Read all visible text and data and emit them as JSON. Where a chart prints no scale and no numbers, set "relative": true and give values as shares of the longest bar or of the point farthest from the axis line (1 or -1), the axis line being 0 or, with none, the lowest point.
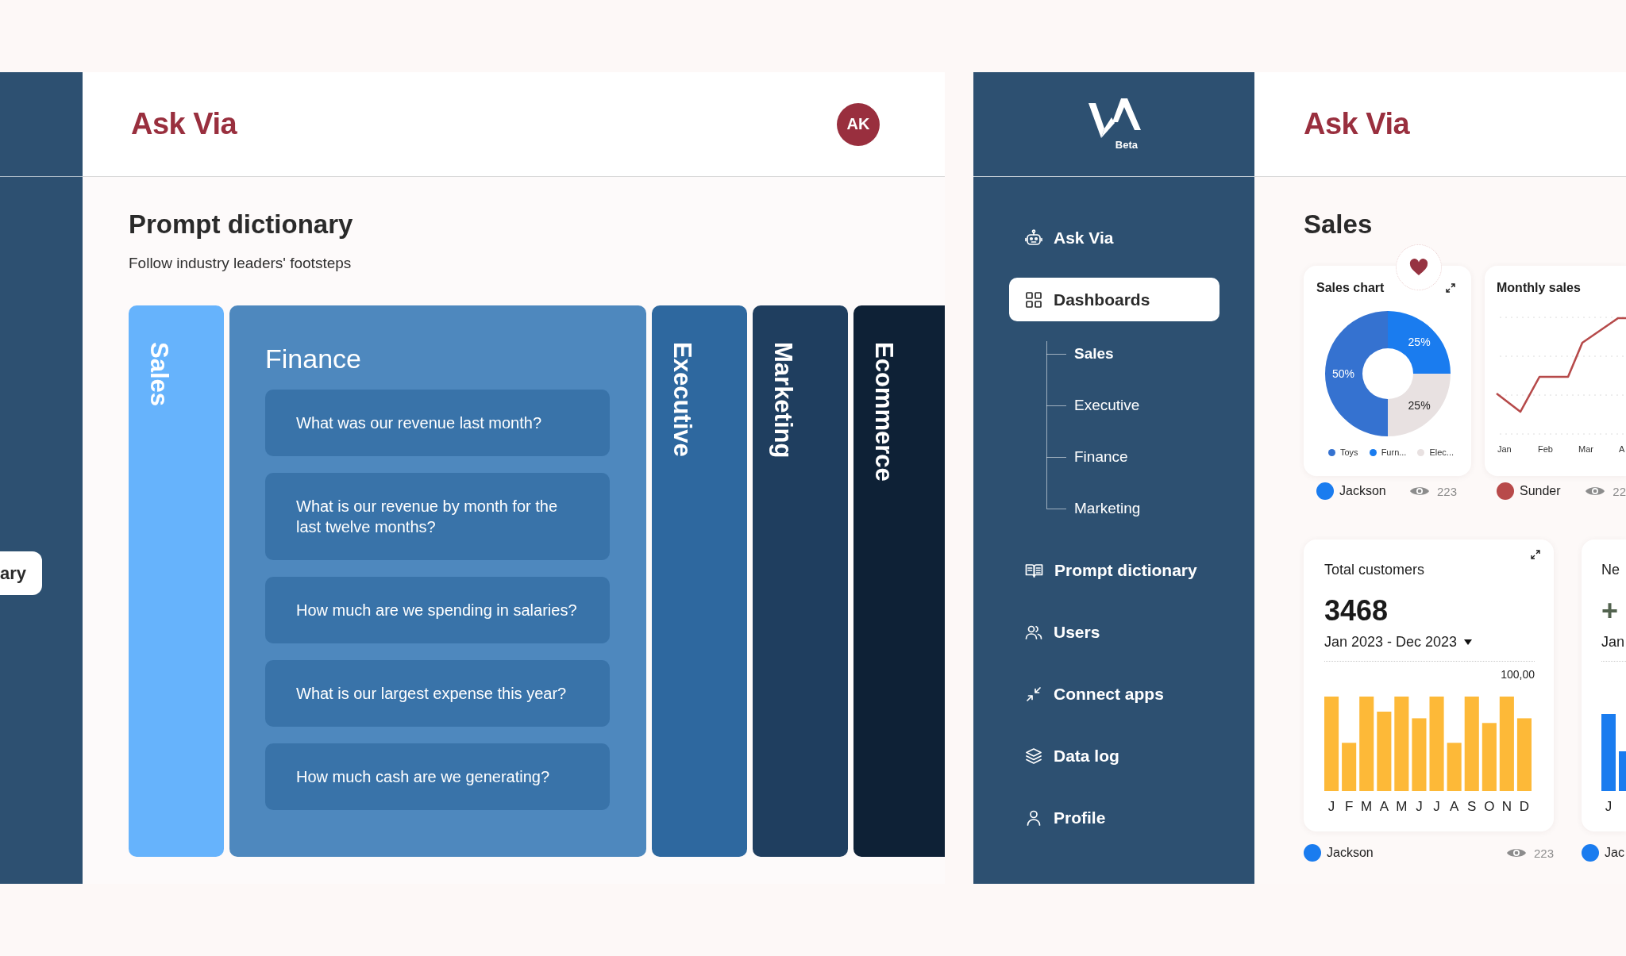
{
  "left_screen": {
    "nav_item": {
      "label": "ary",
      "selected": true
    },
    "header": {
      "title": "Ask Via",
      "avatar": "AK"
    },
    "page": {
      "title": "Prompt dictionary",
      "subtitle": "Follow industry leaders' footsteps"
    },
    "columns": [
      {
        "label": "Sales",
        "expanded": false,
        "color": "#66b3fc"
      },
      {
        "label": "Finance",
        "expanded": true,
        "color": "#4e88be",
        "prompts": [
          "What was our revenue last month?",
          "What is our revenue by month for the last twelve months?",
          "How much are we spending in salaries?",
          "What is our largest expense this year?",
          "How much cash are we generating?"
        ]
      },
      {
        "label": "Executive",
        "expanded": false,
        "color": "#2e689f"
      },
      {
        "label": "Marketing",
        "expanded": false,
        "color": "#1f3e5f"
      },
      {
        "label": "Ecommerce",
        "expanded": false,
        "color": "#0e2136"
      }
    ]
  },
  "right_screen": {
    "logo": {
      "badge": "Beta"
    },
    "sidebar": {
      "items": [
        {
          "label": "Ask Via",
          "selected": false
        },
        {
          "label": "Dashboards",
          "selected": true,
          "children": [
            {
              "label": "Sales",
              "selected": true
            },
            {
              "label": "Executive",
              "selected": false
            },
            {
              "label": "Finance",
              "selected": false
            },
            {
              "label": "Marketing",
              "selected": false
            }
          ]
        },
        {
          "label": "Prompt dictionary",
          "selected": false
        },
        {
          "label": "Users",
          "selected": false
        },
        {
          "label": "Connect apps",
          "selected": false
        },
        {
          "label": "Data log",
          "selected": false
        },
        {
          "label": "Profile",
          "selected": false
        }
      ]
    },
    "header": {
      "title": "Ask Via"
    },
    "page_title": "Sales",
    "cards": [
      {
        "kind": "donut",
        "title": "Sales chart",
        "favorite": true,
        "chart_data": {
          "type": "donut",
          "categories": [
            "Toys",
            "Furn...",
            "Elec..."
          ],
          "values": [
            50,
            25,
            25
          ],
          "colors": [
            "#3572d0",
            "#1a7cef",
            "#e8e1e1"
          ],
          "value_labels": [
            "50%",
            "25%",
            "25%"
          ]
        },
        "owner": {
          "name": "Jackson",
          "color": "#1a7cef"
        },
        "views": "223"
      },
      {
        "kind": "line",
        "title": "Monthly sales",
        "favorite": false,
        "x_labels": [
          "Jan",
          "Feb",
          "Mar",
          "A"
        ],
        "owner": {
          "name": "Sunder",
          "color": "#b84a4a"
        },
        "views": "22"
      },
      {
        "kind": "bar",
        "title": "Total customers",
        "favorite": false,
        "value": "3468",
        "period": "Jan 2023 - Dec 2023",
        "chart_data": {
          "type": "bar",
          "categories": [
            "J",
            "F",
            "M",
            "A",
            "M",
            "J",
            "J",
            "A",
            "S",
            "O",
            "N",
            "D"
          ],
          "values": [
            1,
            0.51,
            1,
            0.84,
            1,
            0.77,
            1,
            0.51,
            1,
            0.72,
            1,
            0.77
          ],
          "color": "#fdb938",
          "relative": true,
          "annotations": [
            "100,00"
          ]
        },
        "owner": {
          "name": "Jackson",
          "color": "#1a7cef"
        },
        "views": "223"
      },
      {
        "kind": "growth",
        "title": "Ne",
        "favorite": false,
        "value": "+",
        "period": "Jan",
        "x_labels": [
          "J"
        ],
        "owner": {
          "name": "Jac",
          "color": "#1a7cef"
        }
      }
    ]
  }
}
